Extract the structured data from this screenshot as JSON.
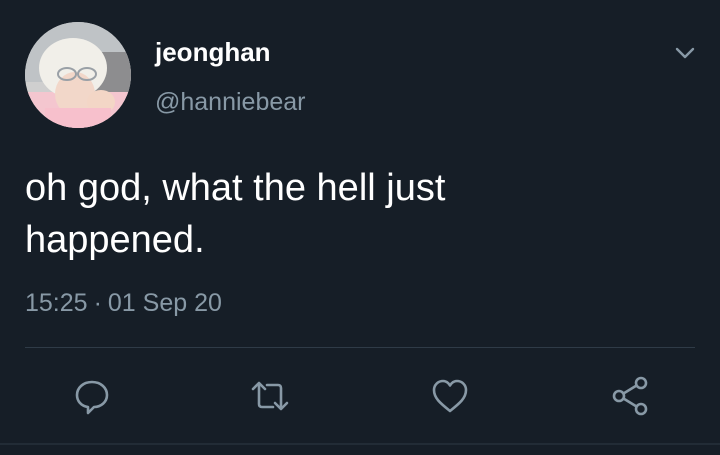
{
  "user": {
    "display_name": "jeonghan",
    "handle": "@hanniebear"
  },
  "tweet": {
    "text_line1": "oh god, what the hell just",
    "text_line2": "happened.",
    "time": "15:25",
    "separator": "·",
    "date": "01 Sep 20"
  },
  "icons": {
    "menu": "chevron-down-icon",
    "reply": "reply-icon",
    "retweet": "retweet-icon",
    "like": "heart-icon",
    "share": "share-icon"
  },
  "colors": {
    "background": "#161e27",
    "primary_text": "#ffffff",
    "secondary_text": "#8899a6",
    "icon": "#8899a6",
    "divider": "#2f3b47"
  }
}
